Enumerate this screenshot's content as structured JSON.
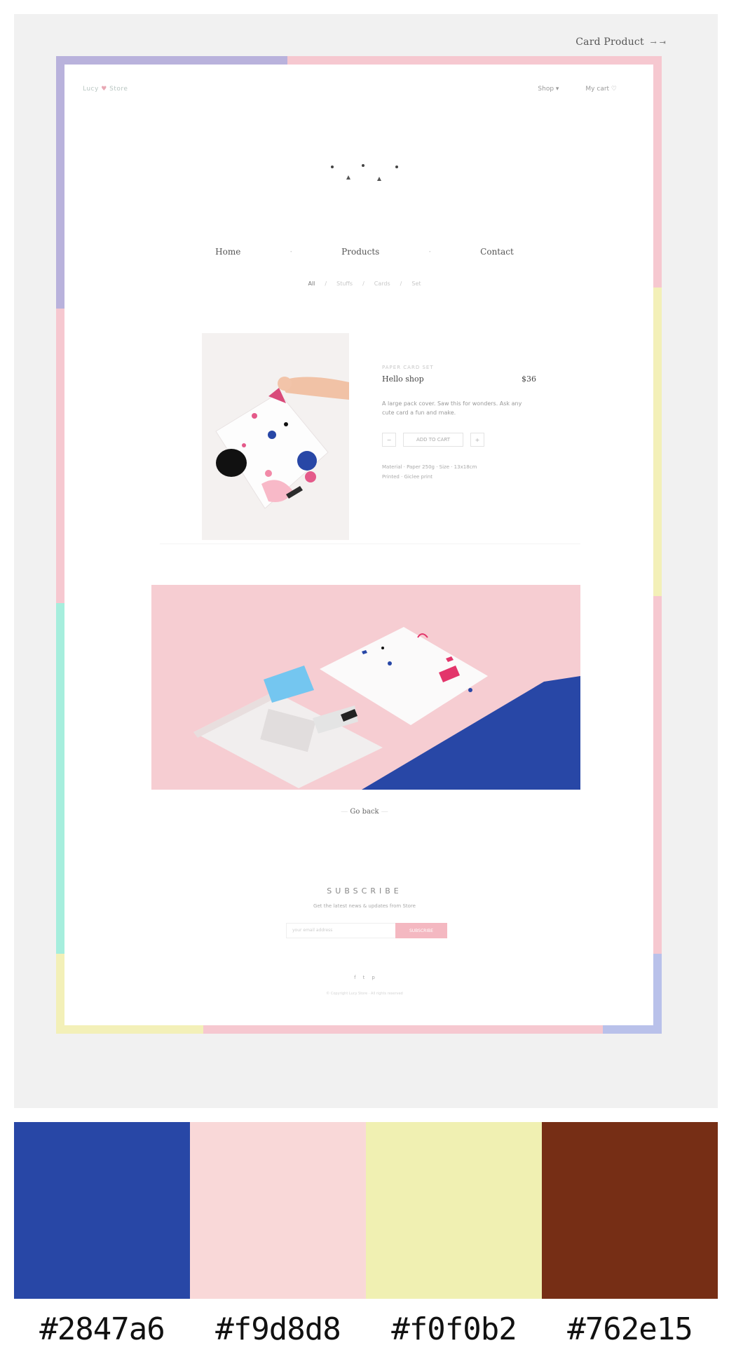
{
  "preview": {
    "title": "Card Product",
    "title_arrow": "→ ⇥",
    "brand": "Lucy",
    "brand_heart": "♥",
    "brand_suffix": "Store",
    "top_nav": [
      "Shop ▾",
      "My cart ♡"
    ],
    "main_nav": [
      "Home",
      "Products",
      "Contact"
    ],
    "main_nav_sep": "·",
    "breadcrumb": [
      "All",
      "/",
      "Stuffs",
      "/",
      "Cards",
      "/",
      "Set"
    ],
    "product": {
      "eyebrow": "PAPER CARD SET",
      "name": "Hello shop",
      "price": "$36",
      "description": "A large pack cover. Saw this for wonders. Ask any cute card a fun and make.",
      "qty_minus": "−",
      "add_label": "ADD TO CART",
      "qty_plus": "+",
      "meta_line_1": "Material · Paper 250g  ·  Size · 13x18cm",
      "meta_line_2": "Printed · Giclee print"
    },
    "back_link": "Go back",
    "subscribe": {
      "title": "SUBSCRIBE",
      "text": "Get the latest news & updates from Store",
      "placeholder": "your email address",
      "button": "SUBSCRIBE"
    },
    "footer_icons": [
      "f",
      "t",
      "p"
    ],
    "footer_copy": "© Copyright Lucy Store · All rights reserved"
  },
  "palette": {
    "colors": [
      "#2847a6",
      "#f9d8d8",
      "#f0f0b2",
      "#762e15"
    ],
    "labels": [
      "#2847a6",
      "#f9d8d8",
      "#f0f0b2",
      "#762e15"
    ]
  }
}
